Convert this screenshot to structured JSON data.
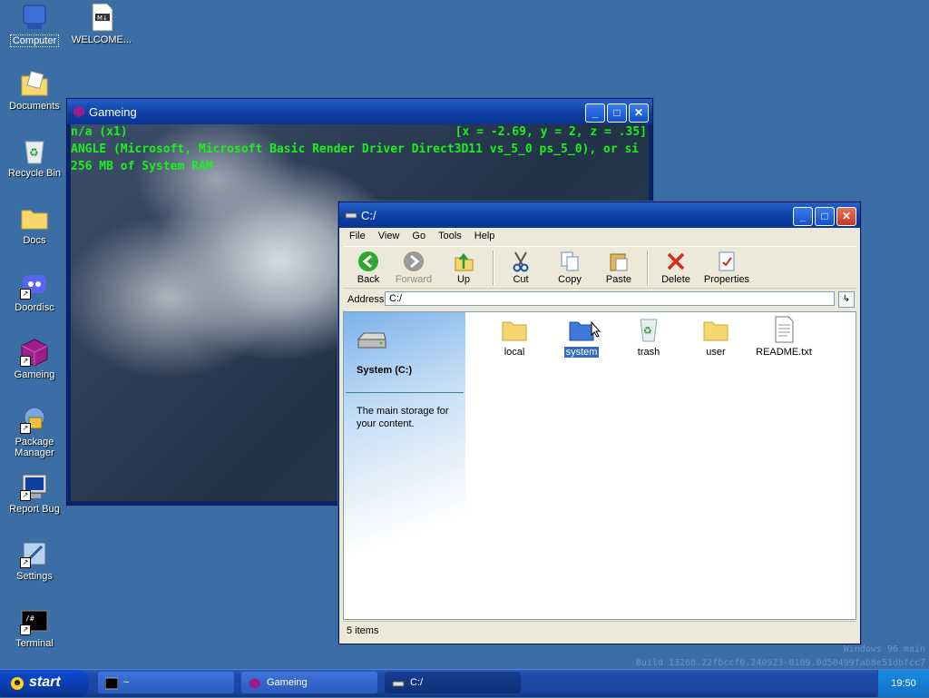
{
  "desktop": {
    "icons": [
      {
        "label": "Computer"
      },
      {
        "label": "WELCOME..."
      },
      {
        "label": "Documents"
      },
      {
        "label": "Recycle Bin"
      },
      {
        "label": "Docs"
      },
      {
        "label": "Doordisc"
      },
      {
        "label": "Gameing"
      },
      {
        "label": "Package Manager"
      },
      {
        "label": "Report Bug"
      },
      {
        "label": "Settings"
      },
      {
        "label": "Terminal"
      }
    ],
    "watermark_line1": "Windows 96 main",
    "watermark_line2": "Build 13268.22fbccf0.240923-0109.0d50499fab8e51dbfcc7"
  },
  "game_window": {
    "title": "Gameing",
    "hud_line1": "n/a (x1)",
    "hud_coords": "[x = -2.69, y = 2, z = .35]",
    "hud_line2": "ANGLE (Microsoft, Microsoft Basic Render Driver Direct3D11 vs_5_0 ps_5_0), or si",
    "hud_line3": "256 MB of System RAM"
  },
  "explorer": {
    "title": "C:/",
    "menu": [
      "File",
      "View",
      "Go",
      "Tools",
      "Help"
    ],
    "toolbar": {
      "back": "Back",
      "forward": "Forward",
      "up": "Up",
      "cut": "Cut",
      "copy": "Copy",
      "paste": "Paste",
      "delete": "Delete",
      "properties": "Properties"
    },
    "address_label": "Address",
    "address_value": "C:/",
    "drive_title": "System (C:)",
    "drive_desc": "The main storage for your content.",
    "files": [
      {
        "name": "local",
        "icon": "folder-icon"
      },
      {
        "name": "system",
        "icon": "folder-blue-icon",
        "selected": true
      },
      {
        "name": "trash",
        "icon": "recycle-bin-icon"
      },
      {
        "name": "user",
        "icon": "folder-icon"
      },
      {
        "name": "README.txt",
        "icon": "text-file-icon"
      }
    ],
    "status": "5 items"
  },
  "taskbar": {
    "start_label": "start",
    "tasks": [
      {
        "label": "~"
      },
      {
        "label": "Gameing"
      },
      {
        "label": "C:/"
      }
    ],
    "clock": "19:50"
  }
}
